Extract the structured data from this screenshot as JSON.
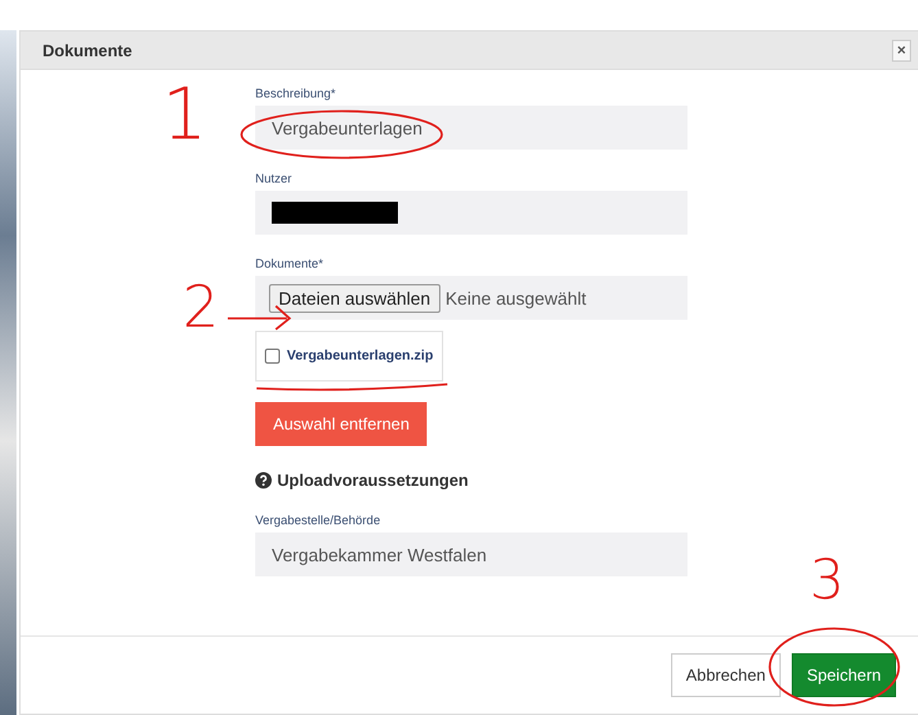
{
  "dialog": {
    "title": "Dokumente",
    "close": "×"
  },
  "fields": [
    {
      "kind": "text",
      "label": "Beschreibung*",
      "value": "Vergabeunterlagen"
    },
    {
      "kind": "redacted",
      "label": "Nutzer"
    },
    {
      "kind": "file",
      "label": "Dokumente*",
      "button": "Dateien auswählen",
      "status": "Keine ausgewählt",
      "files": [
        {
          "name": "Vergabeunterlagen.zip",
          "checked": false
        }
      ],
      "remove_button": "Auswahl entfernen"
    }
  ],
  "info_heading": "Uploadvoraussetzungen",
  "authority": {
    "label": "Vergabestelle/Behörde",
    "value": "Vergabekammer Westfalen"
  },
  "footer": {
    "cancel": "Abbrechen",
    "save": "Speichern"
  },
  "annotations": [
    {
      "number": "1"
    },
    {
      "number": "2"
    },
    {
      "number": "3"
    }
  ]
}
